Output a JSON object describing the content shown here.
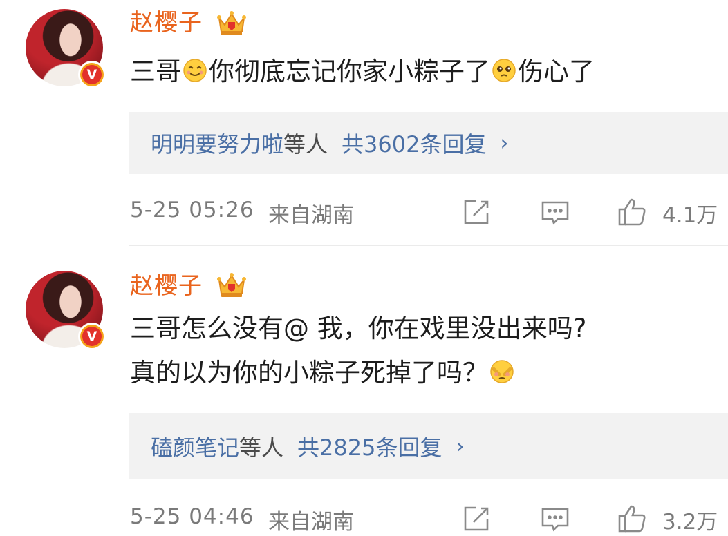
{
  "comments": [
    {
      "author": "赵樱子",
      "text_parts": [
        "三哥",
        "你彻底忘记你家小粽子了",
        "伤心了"
      ],
      "emoji": [
        "smile-emoji",
        "sad-emoji"
      ],
      "replies": {
        "names": "明明要努力啦",
        "etc": "等人",
        "count": "共3602条回复",
        "chevron": "›"
      },
      "time": "5-25 05:26",
      "location": "来自湖南",
      "likes": "4.1万"
    },
    {
      "author": "赵樱子",
      "text_line1": "三哥怎么没有@ 我，你在戏里没出来吗?",
      "text_line2": "真的以为你的小粽子死掉了吗？",
      "emoji": [
        "shy-emoji"
      ],
      "replies": {
        "names": "磕颜笔记",
        "etc": "等人",
        "count": "共2825条回复",
        "chevron": "›"
      },
      "time": "5-25 04:46",
      "location": "来自湖南",
      "likes": "3.2万"
    }
  ],
  "icons": [
    "crown-icon",
    "verified-v-icon",
    "repost-icon",
    "comment-icon",
    "like-icon"
  ],
  "verified_mark": "V",
  "colors": {
    "name": "#e9641e",
    "link": "#4a6fa5",
    "meta": "#7a7a7a",
    "reply_bg": "#f2f2f2",
    "verified": "#e2322b"
  }
}
